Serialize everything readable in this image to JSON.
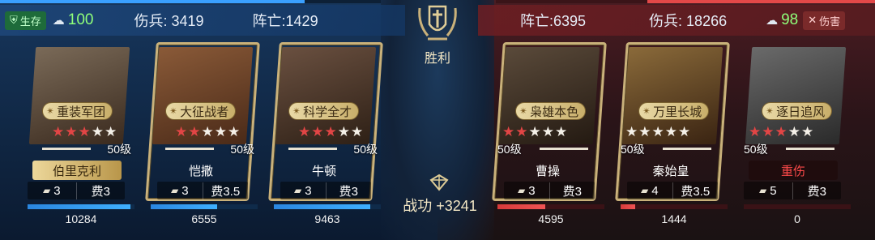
{
  "result": {
    "label": "胜利"
  },
  "left": {
    "status_badge": "生存",
    "morale": "100",
    "wounded_label": "伤兵: 3419",
    "dead_label": "阵亡:1429",
    "cards": [
      {
        "skill": "重装军团",
        "stars": 3,
        "level": "50级",
        "name": "伯里克利",
        "troops": "3",
        "cost": "费3",
        "hp": "10284",
        "hp_ratio": 0.96
      },
      {
        "skill": "大征战者",
        "stars": 2,
        "level": "50级",
        "name": "恺撒",
        "troops": "3",
        "cost": "费3.5",
        "hp": "6555",
        "hp_ratio": 0.62
      },
      {
        "skill": "科学全才",
        "stars": 3,
        "level": "50级",
        "name": "牛顿",
        "troops": "3",
        "cost": "费3",
        "hp": "9463",
        "hp_ratio": 0.9
      }
    ]
  },
  "right": {
    "dead_label": "阵亡:6395",
    "wounded_label": "伤兵: 18266",
    "morale": "98",
    "damage_badge": "伤害",
    "cards": [
      {
        "skill": "枭雄本色",
        "stars": 2,
        "level": "50级",
        "name": "曹操",
        "troops": "3",
        "cost": "费3",
        "hp": "4595",
        "hp_ratio": 0.45
      },
      {
        "skill": "万里长城",
        "stars": 0,
        "level": "50级",
        "name": "秦始皇",
        "troops": "4",
        "cost": "费3.5",
        "hp": "1444",
        "hp_ratio": 0.14
      },
      {
        "skill": "逐日追风",
        "stars": 3,
        "level": "50级",
        "name": "重伤",
        "troops": "5",
        "cost": "费3",
        "hp": "0",
        "hp_ratio": 0.0
      }
    ]
  },
  "merit": {
    "label": "战功 +3241"
  },
  "colors": {
    "blue_side": "#3aa0ff",
    "red_side": "#e34848",
    "gold": "#c9b17a",
    "star_on": "#e24545"
  }
}
